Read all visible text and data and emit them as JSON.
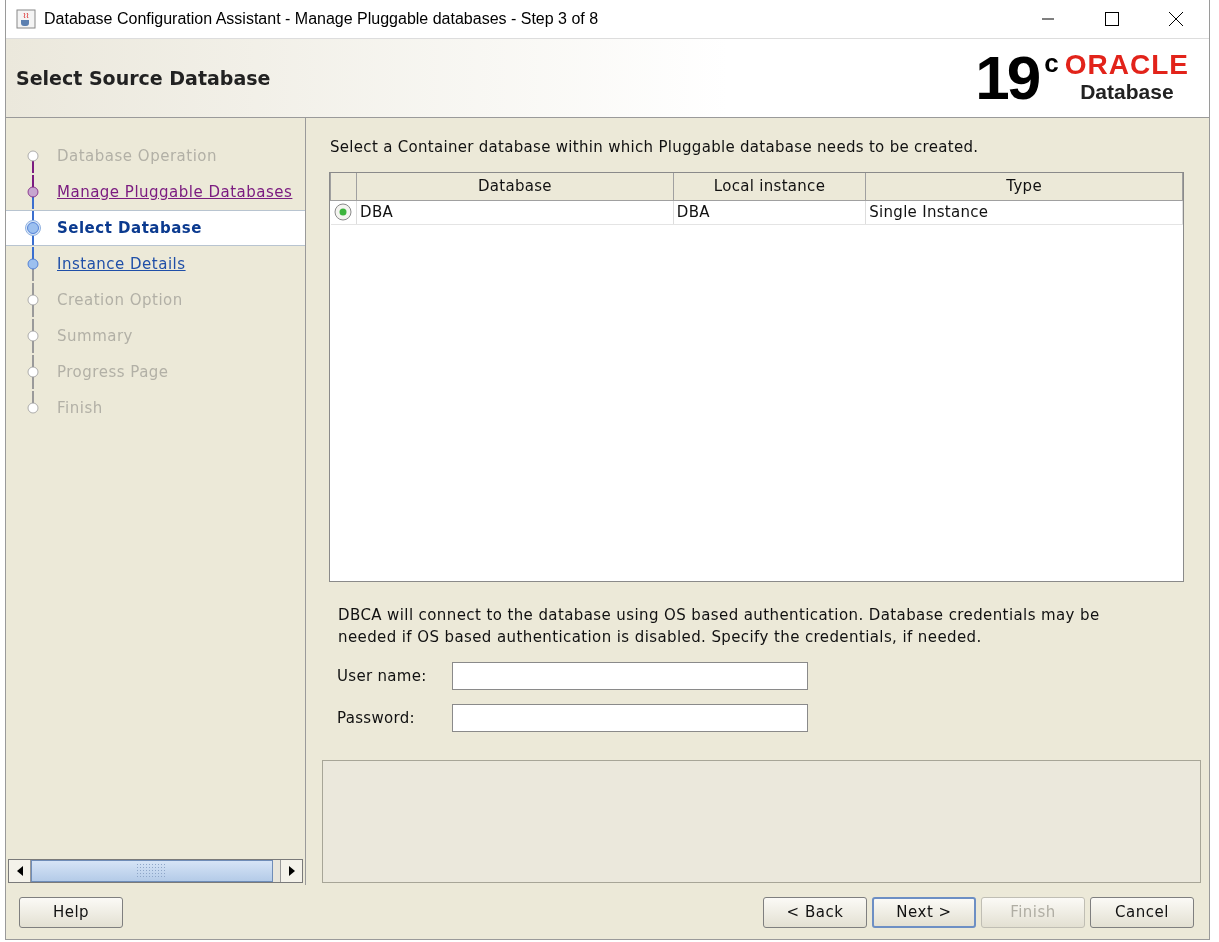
{
  "window": {
    "title": "Database Configuration Assistant - Manage Pluggable databases - Step 3 of 8"
  },
  "header": {
    "title": "Select Source Database",
    "logo": {
      "version": "19",
      "superscript": "c",
      "brand": "ORACLE",
      "product": "Database"
    }
  },
  "steps": [
    {
      "label": "Database Operation",
      "kind": "pending",
      "selected": false
    },
    {
      "label": "Manage Pluggable Databases",
      "kind": "visited",
      "selected": false
    },
    {
      "label": "Select Database",
      "kind": "current",
      "selected": true
    },
    {
      "label": "Instance Details",
      "kind": "link",
      "selected": false
    },
    {
      "label": "Creation Option",
      "kind": "pending",
      "selected": false
    },
    {
      "label": "Summary",
      "kind": "pending",
      "selected": false
    },
    {
      "label": "Progress Page",
      "kind": "pending",
      "selected": false
    },
    {
      "label": "Finish",
      "kind": "pending",
      "selected": false
    }
  ],
  "instruction": "Select a Container database within which Pluggable database needs to be created.",
  "table": {
    "columns": [
      "Database",
      "Local instance",
      "Type"
    ],
    "rows": [
      {
        "cells": [
          "DBA",
          "DBA",
          "Single Instance"
        ],
        "selected": true
      }
    ]
  },
  "credentials_note": "DBCA will connect to the database using OS based authentication. Database credentials may be needed if OS based authentication is disabled. Specify the credentials, if needed.",
  "fields": [
    {
      "label": "User name:"
    },
    {
      "label": "Password:"
    }
  ],
  "buttons": {
    "left": [
      {
        "label": "Help",
        "disabled": false,
        "default": false
      }
    ],
    "right": [
      {
        "label": "< Back",
        "disabled": false,
        "default": false
      },
      {
        "label": "Next >",
        "disabled": false,
        "default": true
      },
      {
        "label": "Finish",
        "disabled": true,
        "default": false
      },
      {
        "label": "Cancel",
        "disabled": false,
        "default": false
      }
    ]
  }
}
